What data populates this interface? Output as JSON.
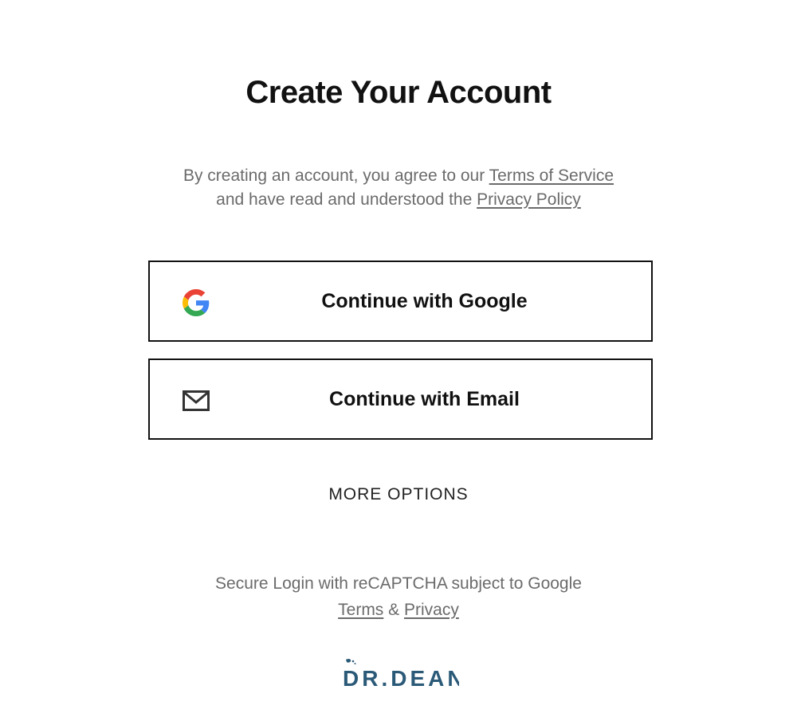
{
  "header": {
    "title": "Create Your Account"
  },
  "legal": {
    "line1_prefix": "By creating an account, you agree to our ",
    "terms_link": "Terms of Service",
    "line2_prefix": "and have read and understood the ",
    "privacy_link": "Privacy Policy"
  },
  "auth": {
    "google_label": "Continue with Google",
    "email_label": "Continue with Email",
    "more_options": "MORE OPTIONS"
  },
  "recaptcha": {
    "text": "Secure Login with reCAPTCHA subject to Google",
    "terms_link": "Terms",
    "separator": " & ",
    "privacy_link": "Privacy"
  },
  "brand": {
    "logo_text": "DR.DEAN",
    "logo_color": "#2b5a78"
  },
  "colors": {
    "google_blue": "#4285F4",
    "google_red": "#EA4335",
    "google_yellow": "#FBBC05",
    "google_green": "#34A853"
  },
  "icons": {
    "google": "google-g-icon",
    "email": "envelope-icon"
  }
}
